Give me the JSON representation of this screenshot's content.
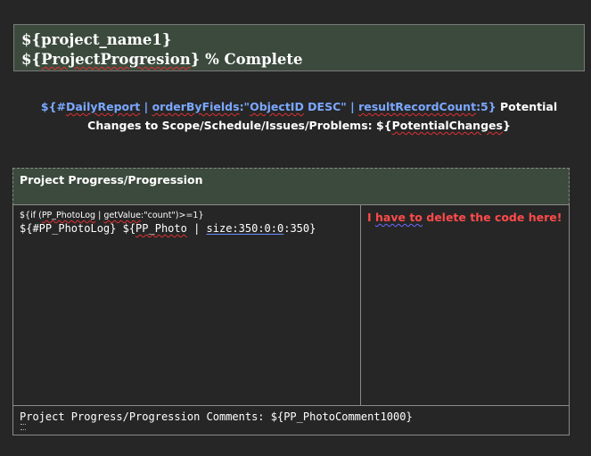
{
  "header": {
    "line1": "${project_name1}",
    "line2_prefix": "${",
    "line2_field": "ProjectProgresion",
    "line2_suffix": "} % Complete"
  },
  "daily_report": {
    "p1": "${#",
    "p2": "DailyReport",
    "p3": " | ",
    "p4": "orderByFields",
    "p5": ":\"",
    "p6": "ObjectID",
    "p7": " DESC\" | ",
    "p8": "resultRecordCount",
    "p9": ":5}",
    "p10": " Potential Changes to Scope/Schedule/Issues/Problems: ${",
    "p11": "PotentialChanges",
    "p12": "}"
  },
  "progress": {
    "title": "Project Progress/Progression",
    "if_p1": "${if (",
    "if_p2": "PP_PhotoLog",
    "if_p3": " | ",
    "if_p4": "getValue",
    "if_p5": ":\"count\")>=1}",
    "log_p1": "${#PP_PhotoLog} ${",
    "log_p2": "PP_Photo",
    "log_p3": " | ",
    "log_p4": "size:350:0:0",
    "log_p5": ":350}",
    "note_p1": "I ",
    "note_p2": "have to",
    "note_p3": " delete the code here!",
    "comments": "Project Progress/Progression Comments: ${PP_PhotoComment1000}"
  },
  "colors": {
    "background": "#262626",
    "header_bg": "#3c4a3d",
    "blue_text": "#7aa7ff",
    "red_text": "#ff4a4a"
  }
}
